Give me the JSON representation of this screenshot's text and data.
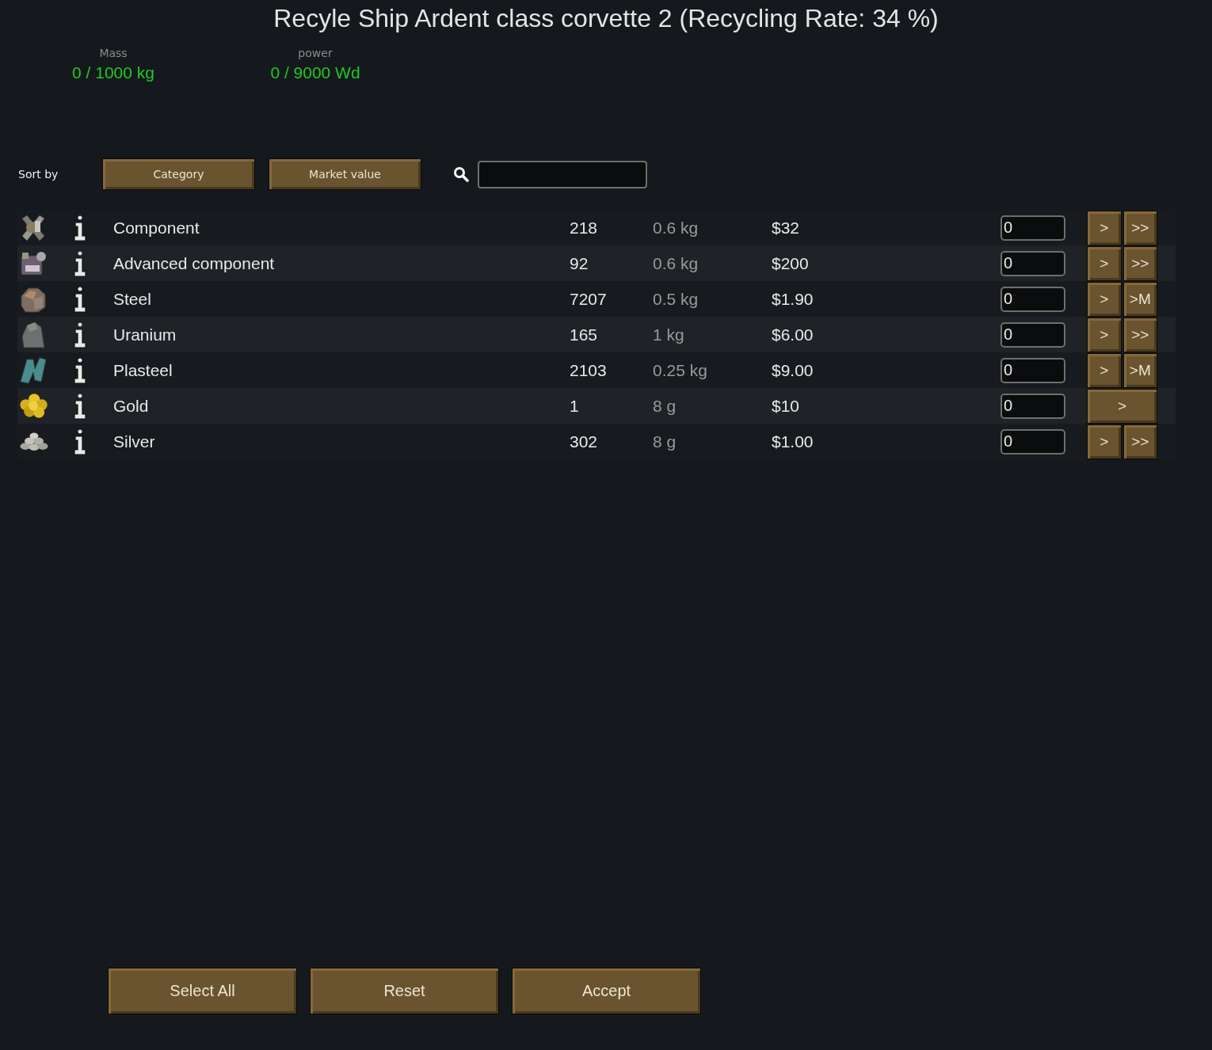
{
  "title": "Recyle Ship Ardent class corvette 2 (Recycling Rate: 34 %)",
  "stats": [
    {
      "label": "Mass",
      "value": "0 / 1000 kg"
    },
    {
      "label": "power",
      "value": "0 / 9000 Wd"
    }
  ],
  "sort": {
    "label": "Sort by",
    "buttons": [
      "Category",
      "Market value"
    ]
  },
  "items": [
    {
      "name": "Component",
      "count": "218",
      "mass": "0.6 kg",
      "value": "$32",
      "quantity": "0",
      "buttons": [
        ">",
        ">>"
      ]
    },
    {
      "name": "Advanced component",
      "count": "92",
      "mass": "0.6 kg",
      "value": "$200",
      "quantity": "0",
      "buttons": [
        ">",
        ">>"
      ]
    },
    {
      "name": "Steel",
      "count": "7207",
      "mass": "0.5 kg",
      "value": "$1.90",
      "quantity": "0",
      "buttons": [
        ">",
        ">M"
      ]
    },
    {
      "name": "Uranium",
      "count": "165",
      "mass": "1 kg",
      "value": "$6.00",
      "quantity": "0",
      "buttons": [
        ">",
        ">>"
      ]
    },
    {
      "name": "Plasteel",
      "count": "2103",
      "mass": "0.25 kg",
      "value": "$9.00",
      "quantity": "0",
      "buttons": [
        ">",
        ">M"
      ]
    },
    {
      "name": "Gold",
      "count": "1",
      "mass": "8 g",
      "value": "$10",
      "quantity": "0",
      "buttons": [
        ">"
      ]
    },
    {
      "name": "Silver",
      "count": "302",
      "mass": "8 g",
      "value": "$1.00",
      "quantity": "0",
      "buttons": [
        ">",
        ">>"
      ]
    }
  ],
  "actions": [
    "Select All",
    "Reset",
    "Accept"
  ]
}
